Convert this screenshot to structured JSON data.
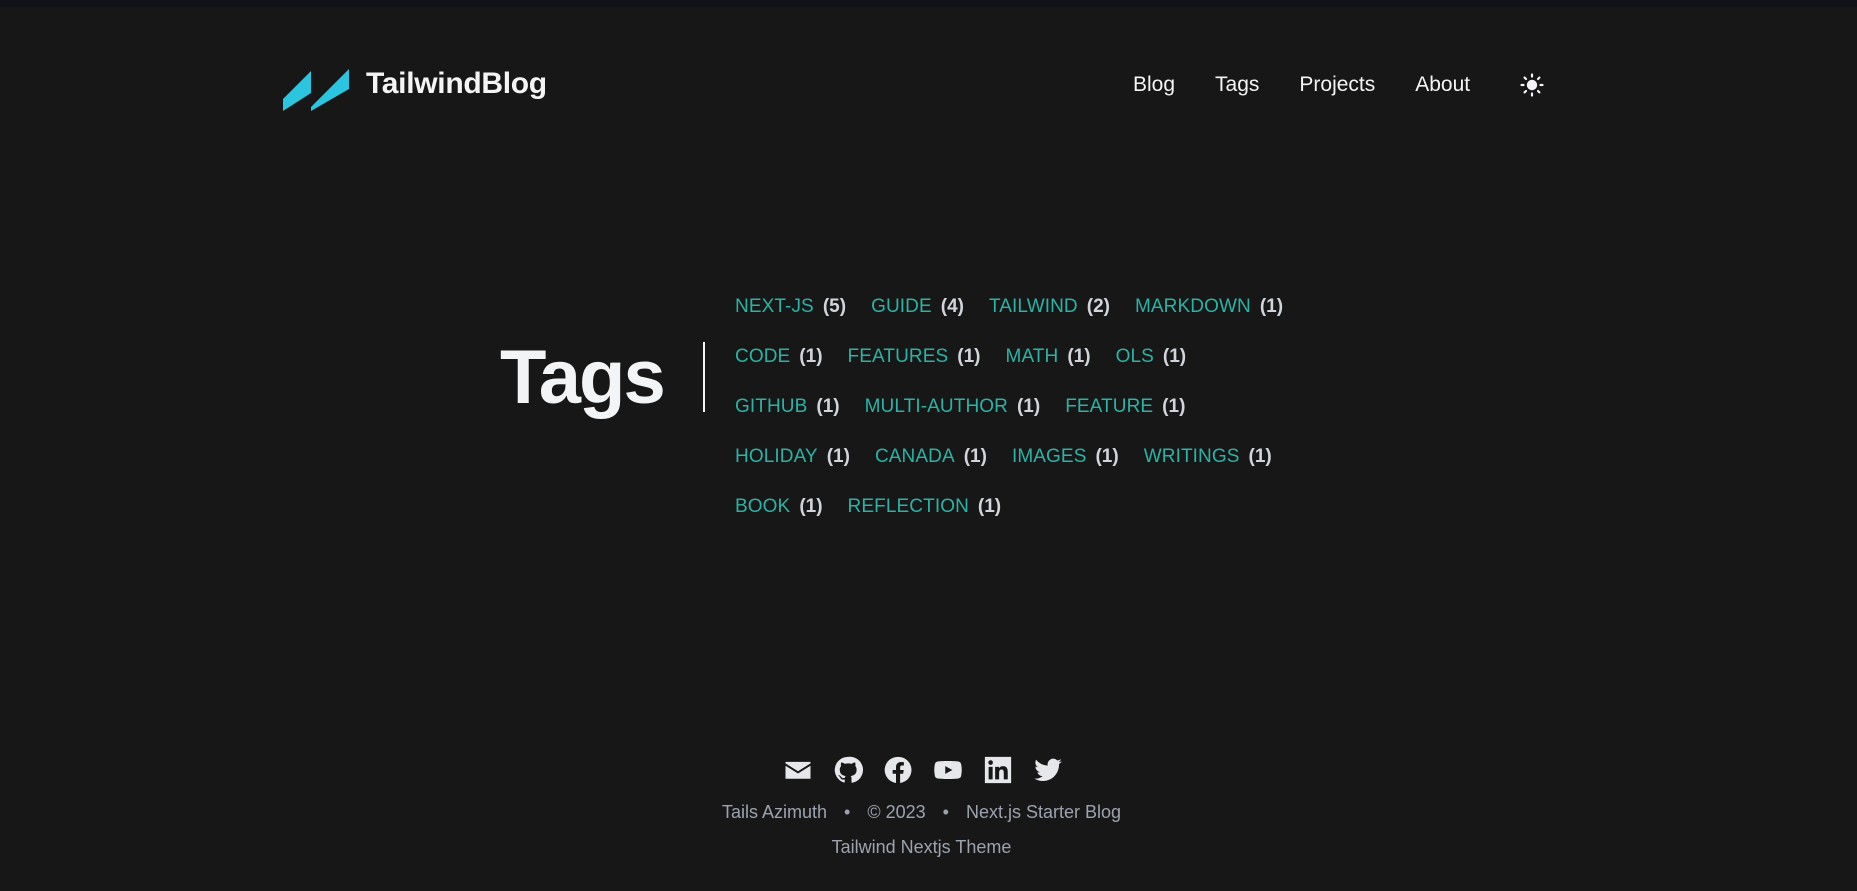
{
  "header": {
    "site_title": "TailwindBlog",
    "logo_color": "#2cc5e0",
    "nav": [
      {
        "label": "Blog"
      },
      {
        "label": "Tags"
      },
      {
        "label": "Projects"
      },
      {
        "label": "About"
      }
    ],
    "theme_toggle_icon": "sun-icon"
  },
  "main": {
    "heading": "Tags",
    "accent_color": "#2bb3a5",
    "tags": [
      {
        "name": "NEXT-JS",
        "count": "(5)"
      },
      {
        "name": "GUIDE",
        "count": "(4)"
      },
      {
        "name": "TAILWIND",
        "count": "(2)"
      },
      {
        "name": "MARKDOWN",
        "count": "(1)"
      },
      {
        "name": "CODE",
        "count": "(1)"
      },
      {
        "name": "FEATURES",
        "count": "(1)"
      },
      {
        "name": "MATH",
        "count": "(1)"
      },
      {
        "name": "OLS",
        "count": "(1)"
      },
      {
        "name": "GITHUB",
        "count": "(1)"
      },
      {
        "name": "MULTI-AUTHOR",
        "count": "(1)"
      },
      {
        "name": "FEATURE",
        "count": "(1)"
      },
      {
        "name": "HOLIDAY",
        "count": "(1)"
      },
      {
        "name": "CANADA",
        "count": "(1)"
      },
      {
        "name": "IMAGES",
        "count": "(1)"
      },
      {
        "name": "WRITINGS",
        "count": "(1)"
      },
      {
        "name": "BOOK",
        "count": "(1)"
      },
      {
        "name": "REFLECTION",
        "count": "(1)"
      }
    ]
  },
  "footer": {
    "social_icons": [
      "mail-icon",
      "github-icon",
      "facebook-icon",
      "youtube-icon",
      "linkedin-icon",
      "twitter-icon"
    ],
    "author": "Tails Azimuth",
    "separator": "•",
    "copyright": "© 2023",
    "site_name": "Next.js Starter Blog",
    "theme_credit": "Tailwind Nextjs Theme"
  }
}
